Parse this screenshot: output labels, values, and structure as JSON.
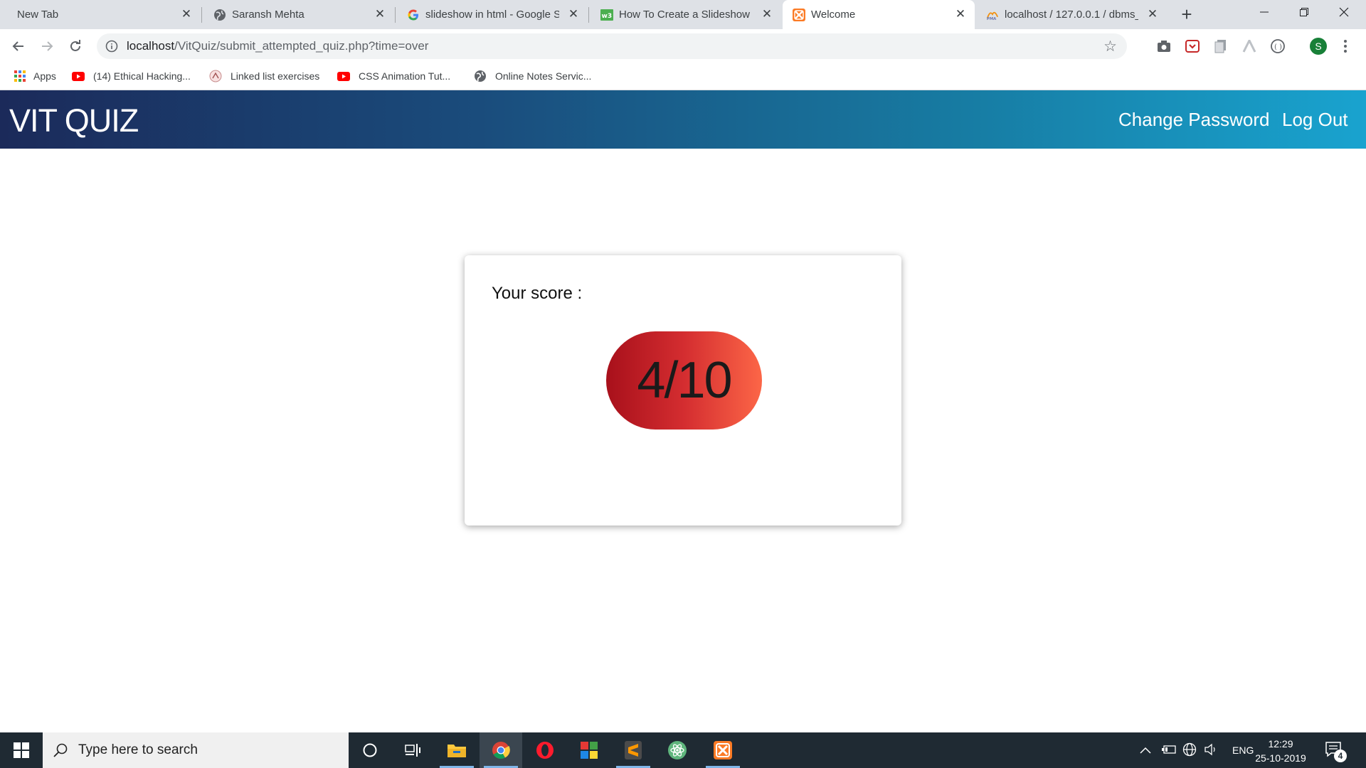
{
  "browser": {
    "tabs": [
      {
        "title": "New Tab",
        "icon": "none",
        "active": false
      },
      {
        "title": "Saransh Mehta",
        "icon": "globe-icon",
        "active": false
      },
      {
        "title": "slideshow in html - Google S",
        "icon": "google-icon",
        "active": false
      },
      {
        "title": "How To Create a Slideshow",
        "icon": "w3schools-icon",
        "active": false
      },
      {
        "title": "Welcome",
        "icon": "xampp-icon",
        "active": true
      },
      {
        "title": "localhost / 127.0.0.1 / dbms_",
        "icon": "phpmyadmin-icon",
        "active": false
      }
    ],
    "close_glyph": "✕",
    "new_tab_glyph": "+",
    "url_host": "localhost",
    "url_path": "/VitQuiz/submit_attempted_quiz.php?time=over",
    "profile_initial": "S",
    "bookmarks": [
      {
        "label": "Apps",
        "icon": "apps-grid-icon"
      },
      {
        "label": "(14) Ethical Hacking...",
        "icon": "youtube-icon"
      },
      {
        "label": "Linked list exercises",
        "icon": "site-icon"
      },
      {
        "label": "CSS Animation Tut...",
        "icon": "youtube-icon"
      },
      {
        "label": "Online Notes Servic...",
        "icon": "globe-icon"
      }
    ]
  },
  "site": {
    "title": "VIT QUIZ",
    "nav": [
      {
        "label": "Change Password"
      },
      {
        "label": "Log Out"
      }
    ],
    "header_colors": [
      "#1b2a5a",
      "#19a3cf"
    ]
  },
  "result": {
    "label": "Your score :",
    "score": "4/10",
    "pill_colors": [
      "#a8101b",
      "#fc6647"
    ]
  },
  "taskbar": {
    "search_placeholder": "Type here to search",
    "language": "ENG",
    "time": "12:29",
    "date": "25-10-2019",
    "notification_count": "4"
  }
}
